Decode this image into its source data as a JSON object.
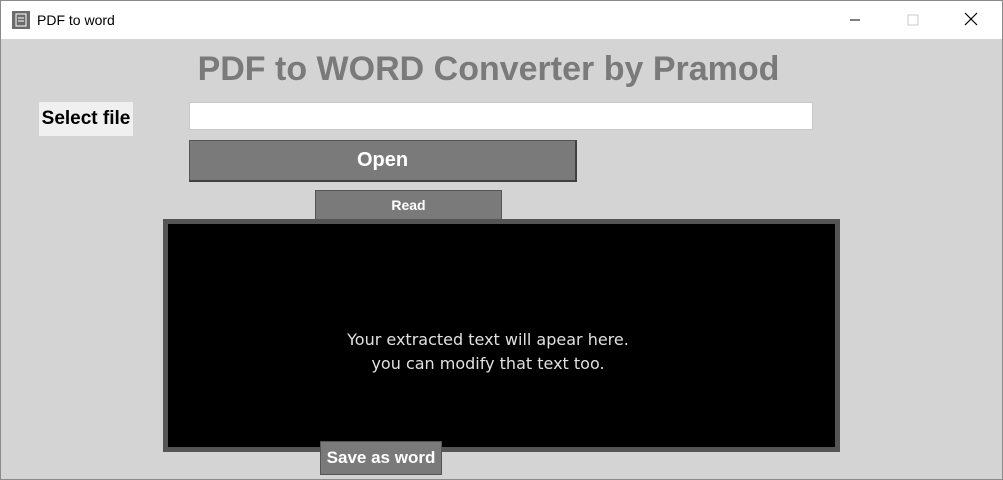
{
  "window": {
    "title": "PDF to word",
    "icon": "document-icon",
    "controls": [
      "minimize-icon",
      "maximize-icon",
      "close-icon"
    ]
  },
  "app": {
    "heading": "PDF to WORD Converter by Pramod",
    "select_file_label": "Select file",
    "file_input": {
      "value": "",
      "placeholder": ""
    },
    "open_button": "Open",
    "read_button": "Read",
    "text_area": {
      "line1": "Your extracted text will apear here.",
      "line2": "you can modify that text too."
    },
    "save_button": "Save as word"
  },
  "colors": {
    "heading": "#7a7a7a",
    "button": "#7a7a7a",
    "background": "#d4d4d4",
    "text_area_bg": "#000000"
  }
}
